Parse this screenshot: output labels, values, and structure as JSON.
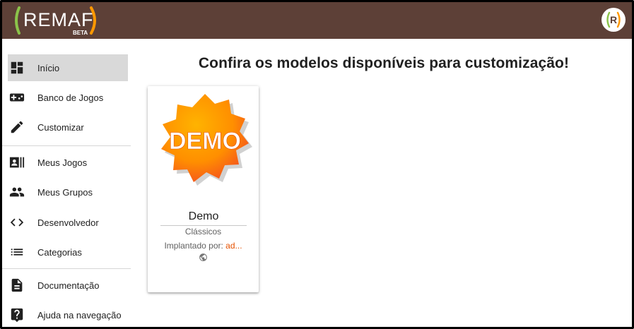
{
  "app": {
    "logo_text": "REMAF",
    "logo_badge": "BETA",
    "avatar_letter": "R"
  },
  "sidebar": {
    "items": [
      {
        "label": "Início",
        "icon": "dashboard-icon"
      },
      {
        "label": "Banco de Jogos",
        "icon": "gamepad-icon"
      },
      {
        "label": "Customizar",
        "icon": "pencil-icon"
      },
      {
        "label": "Meus Jogos",
        "icon": "contacts-icon"
      },
      {
        "label": "Meus Grupos",
        "icon": "group-icon"
      },
      {
        "label": "Desenvolvedor",
        "icon": "code-icon"
      },
      {
        "label": "Categorias",
        "icon": "list-icon"
      },
      {
        "label": "Documentação",
        "icon": "document-icon"
      },
      {
        "label": "Ajuda na navegação",
        "icon": "help-icon"
      }
    ]
  },
  "main": {
    "title": "Confira os modelos disponíveis para customização!",
    "cards": [
      {
        "image_text": "DEMO",
        "title": "Demo",
        "category": "Clássicos",
        "author_prefix": "Implantado por: ",
        "author": "ad...",
        "visibility_icon": "globe-icon"
      }
    ]
  },
  "colors": {
    "topbar": "#5d4037",
    "logo_green": "#8bc34a",
    "logo_orange": "#ff9800",
    "active_item": "#d9d9d9",
    "author_link": "#e65100",
    "badge_orange": "#ff8f00"
  }
}
